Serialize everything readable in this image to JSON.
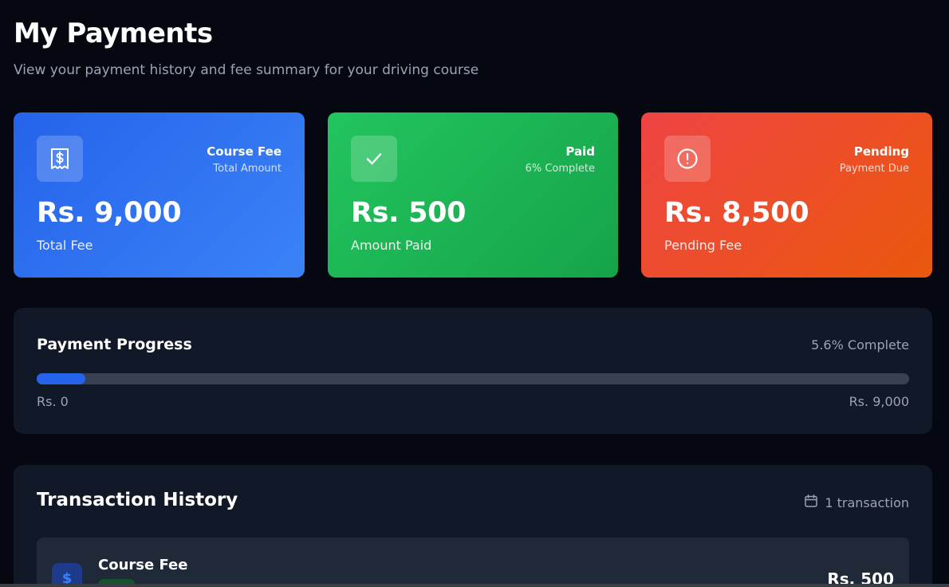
{
  "header": {
    "title": "My Payments",
    "subtitle": "View your payment history and fee summary for your driving course"
  },
  "cards": {
    "course": {
      "icon": "receipt-dollar-icon",
      "title": "Course Fee",
      "subtitle": "Total Amount",
      "amount": "Rs. 9,000",
      "label": "Total Fee",
      "color": "#2563eb"
    },
    "paid": {
      "icon": "check-icon",
      "title": "Paid",
      "subtitle": "6% Complete",
      "amount": "Rs. 500",
      "label": "Amount Paid",
      "color": "#22c55e"
    },
    "pending": {
      "icon": "alert-circle-icon",
      "title": "Pending",
      "subtitle": "Payment Due",
      "amount": "Rs. 8,500",
      "label": "Pending Fee",
      "color": "#ef4444"
    }
  },
  "progress": {
    "title": "Payment Progress",
    "percent_label": "5.6% Complete",
    "percent": 5.6,
    "min_label": "Rs. 0",
    "max_label": "Rs. 9,000"
  },
  "history": {
    "title": "Transaction History",
    "count_icon": "calendar-icon",
    "count_label": "1 transaction",
    "transactions": [
      {
        "icon": "dollar-icon",
        "title": "Course Fee",
        "amount": "Rs. 500"
      }
    ]
  }
}
